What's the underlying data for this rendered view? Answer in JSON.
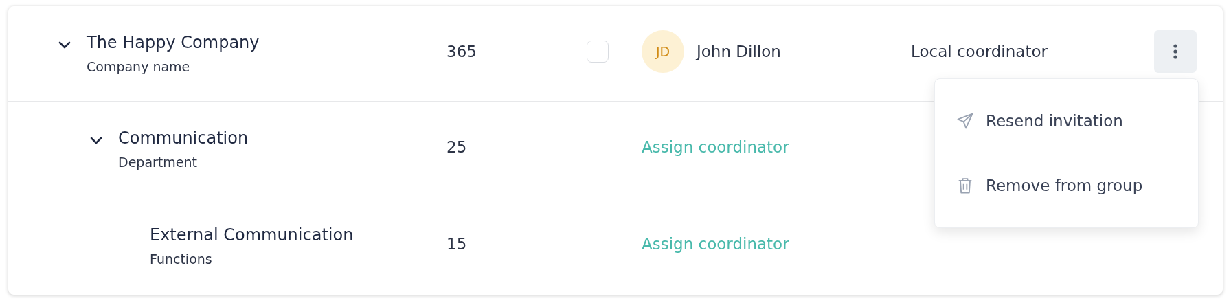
{
  "rows": [
    {
      "name": "The Happy Company",
      "type_label": "Company name",
      "count": "365",
      "expanded": true,
      "checkbox": {
        "checked": false
      },
      "coordinator": {
        "initials": "JD",
        "name": "John Dillon"
      },
      "role": "Local coordinator",
      "actions_menu": {
        "open": true,
        "items": [
          {
            "kind": "send",
            "label": "Resend invitation"
          },
          {
            "kind": "trash",
            "label": "Remove from group"
          }
        ]
      },
      "children": [
        {
          "name": "Communication",
          "type_label": "Department",
          "count": "25",
          "expanded": true,
          "assign_link": "Assign coordinator",
          "children": [
            {
              "name": "External Communication",
              "type_label": "Functions",
              "count": "15",
              "assign_link": "Assign coordinator"
            }
          ]
        }
      ]
    }
  ]
}
